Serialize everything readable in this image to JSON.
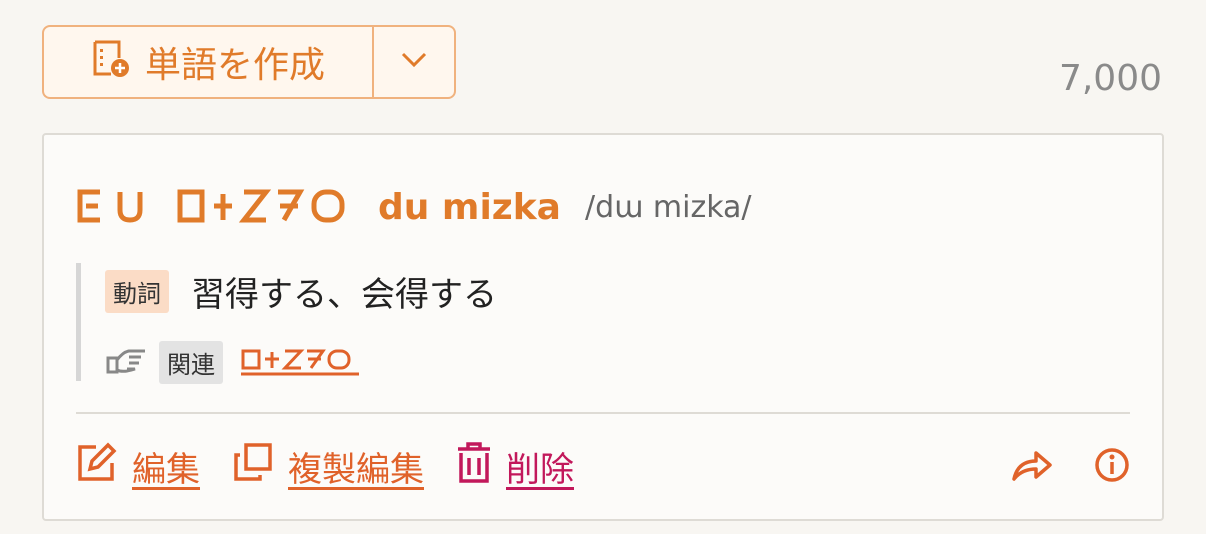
{
  "toolbar": {
    "create_label": "単語を作成",
    "create_icon": "new-document-icon",
    "dropdown_icon": "chevron-down-icon"
  },
  "word_count": "7,000",
  "word": {
    "romanization": "du mizka",
    "pronunciation": "/dɯ mizka/",
    "definitions": [
      {
        "part_of_speech": "動詞",
        "meaning": "習得する、会得する"
      }
    ],
    "relations": [
      {
        "label": "関連",
        "icon": "pointing-hand-icon",
        "target_script": "mizka"
      }
    ]
  },
  "actions": {
    "edit_label": "編集",
    "duplicate_label": "複製編集",
    "delete_label": "削除",
    "share_icon": "share-icon",
    "info_icon": "info-icon"
  },
  "colors": {
    "accent": "#e07b2a",
    "action": "#e0622a",
    "delete": "#c2185b",
    "pos_badge": "#fbdcc6",
    "relation_badge": "#e3e3e3"
  }
}
